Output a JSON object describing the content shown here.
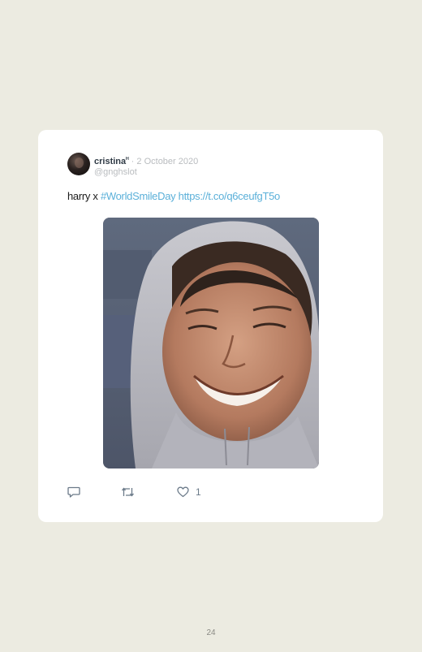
{
  "tweet": {
    "display_name": "cristina",
    "name_suffix": "ᴴ",
    "separator": " · ",
    "date": "2 October 2020",
    "handle": "@gnghslot",
    "text_prefix": "harry x ",
    "hashtag": "#WorldSmileDay",
    "link": "https://t.co/q6ceufgT5o",
    "media_icon": "photo-of-smiling-person-in-grey-hood",
    "actions": {
      "reply_icon": "reply-icon",
      "retweet_icon": "retweet-icon",
      "like_icon": "heart-icon",
      "like_count": "1"
    }
  },
  "page": {
    "number": "24"
  },
  "colors": {
    "background": "#ecebe1",
    "card": "#ffffff",
    "link": "#5bb0d9",
    "muted": "#b9bcbf",
    "icon": "#6b7a89"
  }
}
